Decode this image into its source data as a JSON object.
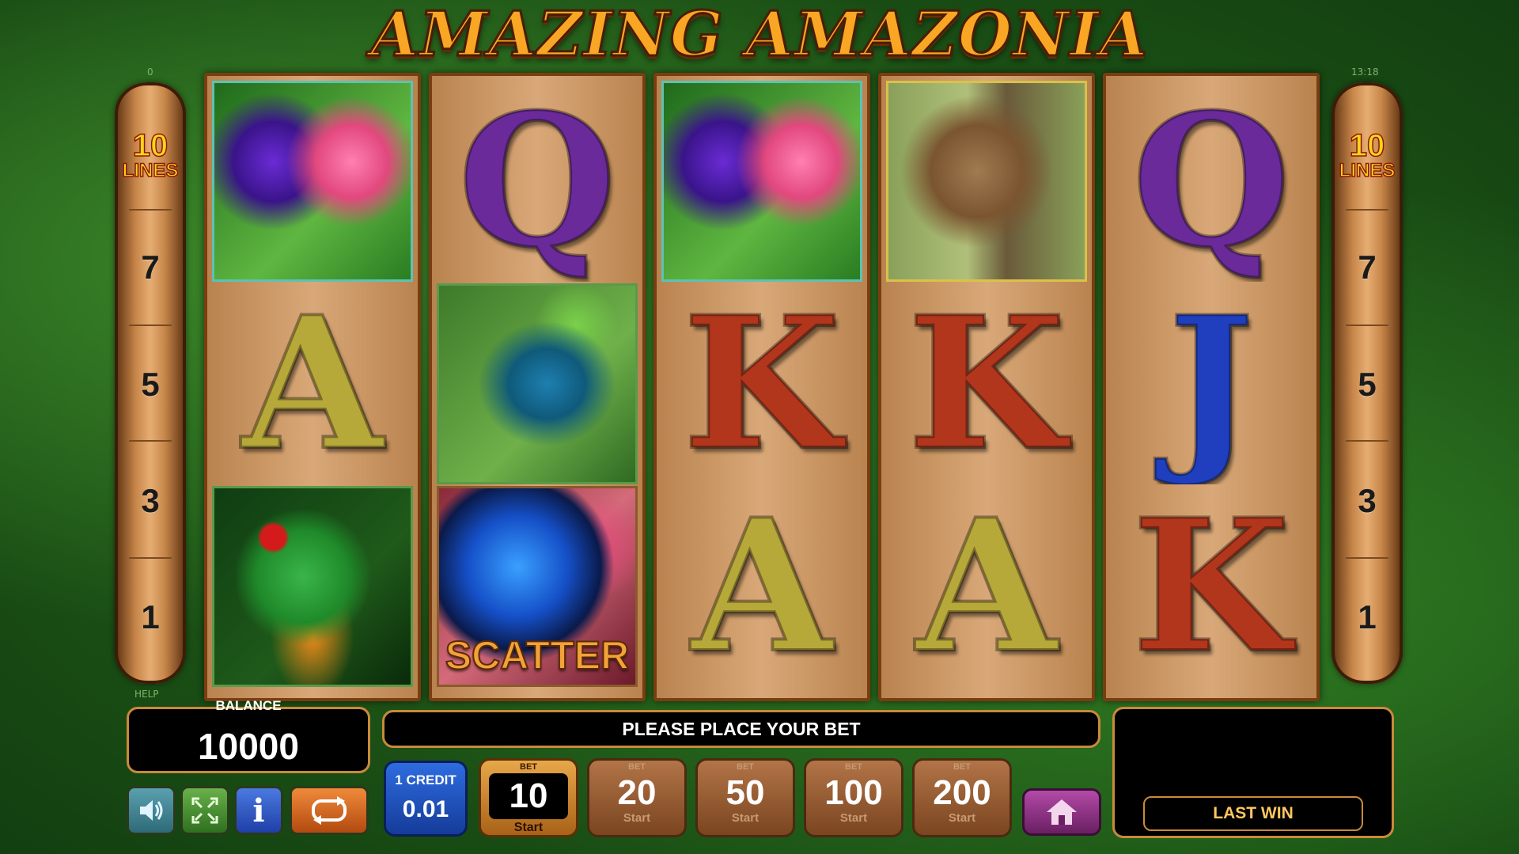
{
  "game": {
    "title": "AMAZING AMAZONIA",
    "corner_left_value": "0",
    "clock": "13:18",
    "help_label": "HELP"
  },
  "lines_panel": {
    "count": "10",
    "label": "LINES",
    "markers": [
      "7",
      "5",
      "3",
      "1"
    ]
  },
  "reels": [
    [
      "hummingbird",
      "A",
      "frog"
    ],
    [
      "Q",
      "lizard",
      "butterfly-scatter"
    ],
    [
      "hummingbird",
      "K",
      "A"
    ],
    [
      "sloth",
      "K",
      "A"
    ],
    [
      "Q",
      "J",
      "K"
    ]
  ],
  "symbols": {
    "scatter_label": "SCATTER",
    "letter_colors": {
      "A": "#b7a83a",
      "K": "#b2361c",
      "Q": "#6a2a9a",
      "J": "#1f3fbf"
    }
  },
  "balance": {
    "label": "BALANCE",
    "value": "10000"
  },
  "message": "PLEASE PLACE YOUR BET",
  "last_win": {
    "label": "LAST WIN",
    "value": ""
  },
  "credit": {
    "label": "1 CREDIT",
    "value": "0.01"
  },
  "bets": [
    {
      "tag": "BET",
      "value": "10",
      "start": "Start",
      "active": true
    },
    {
      "tag": "BET",
      "value": "20",
      "start": "Start",
      "active": false
    },
    {
      "tag": "BET",
      "value": "50",
      "start": "Start",
      "active": false
    },
    {
      "tag": "BET",
      "value": "100",
      "start": "Start",
      "active": false
    },
    {
      "tag": "BET",
      "value": "200",
      "start": "Start",
      "active": false
    }
  ],
  "controls": {
    "sound_icon": "speaker-icon",
    "fullscreen_icon": "fullscreen-icon",
    "info_label": "i",
    "autoplay_icon": "autoplay-icon",
    "home_icon": "home-icon"
  },
  "colors": {
    "accent_orange": "#f8a624",
    "panel_border": "#c98a3a",
    "credit_blue": "#2e6ce0",
    "home_purple": "#b34aa8"
  }
}
